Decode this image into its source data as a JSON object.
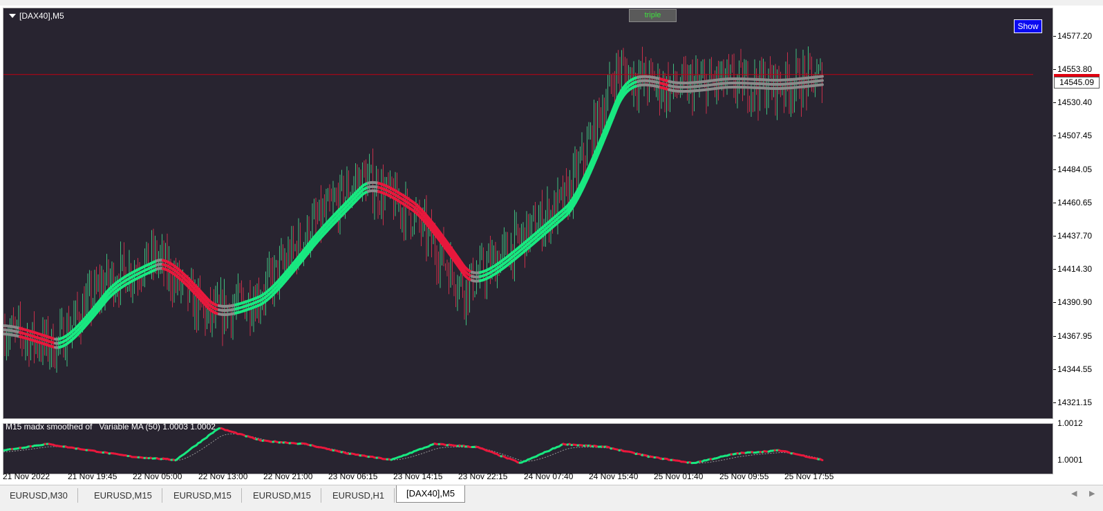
{
  "chart": {
    "symbol_label": "[DAX40],M5",
    "triple_button": "triple",
    "show_button": "Show",
    "current_price": "14545.09",
    "price_ticks": [
      "14577.20",
      "14553.80",
      "14530.40",
      "14507.45",
      "14484.05",
      "14460.65",
      "14437.70",
      "14414.30",
      "14390.90",
      "14367.95",
      "14344.55",
      "14321.15"
    ],
    "time_ticks": [
      "21 Nov 2022",
      "21 Nov 19:45",
      "22 Nov 05:00",
      "22 Nov 13:00",
      "22 Nov 21:00",
      "23 Nov 06:15",
      "23 Nov 14:15",
      "23 Nov 22:15",
      "24 Nov 07:40",
      "24 Nov 15:40",
      "25 Nov 01:40",
      "25 Nov 09:55",
      "25 Nov 17:55"
    ]
  },
  "subwindow": {
    "label": "M15 madx smoothed of   Variable MA (50) 1.0003 1.0002",
    "ticks": [
      "1.0012",
      "1.0001"
    ]
  },
  "tabs": [
    {
      "label": "EURUSD,M30",
      "active": false
    },
    {
      "label": "EURUSD,M15",
      "active": false
    },
    {
      "label": "EURUSD,M15",
      "active": false
    },
    {
      "label": "EURUSD,M15",
      "active": false
    },
    {
      "label": "EURUSD,H1",
      "active": false
    },
    {
      "label": "[DAX40],M5",
      "active": true
    }
  ],
  "colors": {
    "background": "#282430",
    "bull_band": "#18e880",
    "bear_band": "#e8183c",
    "neutral_band": "#8a8a8a",
    "current_price_line": "#c00010"
  },
  "chart_data": {
    "type": "line",
    "title": "[DAX40],M5",
    "ylim": [
      14312,
      14590
    ],
    "current_price": 14545.09,
    "x": [
      "21 Nov 2022",
      "21 Nov 19:45",
      "22 Nov 05:00",
      "22 Nov 13:00",
      "22 Nov 21:00",
      "23 Nov 06:15",
      "23 Nov 14:15",
      "23 Nov 22:15",
      "24 Nov 07:40",
      "24 Nov 15:40",
      "25 Nov 01:40",
      "25 Nov 09:55",
      "25 Nov 17:55"
    ],
    "series": [
      {
        "values": [
          14372,
          14360,
          14405,
          14420,
          14380,
          14395,
          14440,
          14475,
          14450,
          14400,
          14430,
          14460,
          14548,
          14535,
          14540,
          14538,
          14542
        ]
      }
    ],
    "sub_series": {
      "ylim": [
        1.0,
        1.0013
      ],
      "values": [
        1.0006,
        1.0008,
        1.0006,
        1.0004,
        1.0003,
        1.0013,
        1.0009,
        1.0008,
        1.0005,
        1.0003,
        1.0008,
        1.0007,
        1.0002,
        1.0008,
        1.0007,
        1.0004,
        1.0002,
        1.0005,
        1.0006,
        1.0003
      ]
    }
  }
}
